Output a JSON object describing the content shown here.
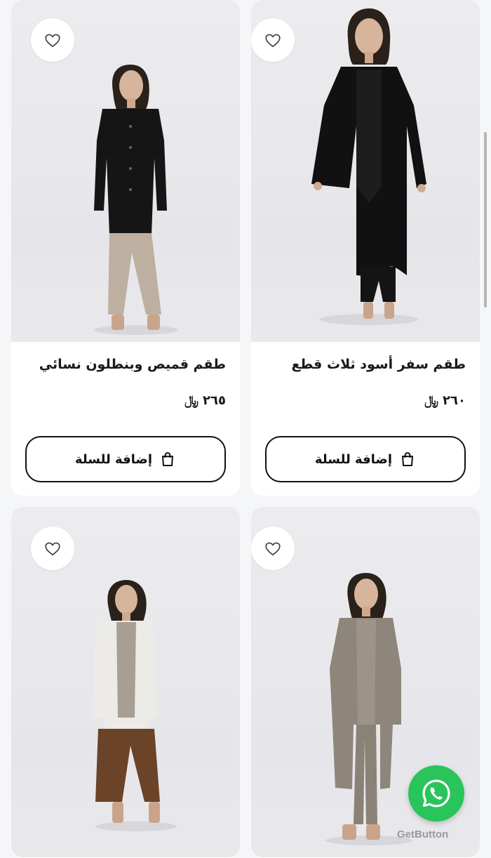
{
  "products": [
    {
      "title": "طقم سفر أسود ثلاث قطع",
      "price": "٢٦٠",
      "currency": "﷼",
      "add_label": "إضافة للسلة"
    },
    {
      "title": "طقم قميص وبنطلون نسائي",
      "price": "٢٦٥",
      "currency": "﷼",
      "add_label": "إضافة للسلة"
    },
    {
      "title": "",
      "price": "",
      "currency": "",
      "add_label": ""
    },
    {
      "title": "",
      "price": "",
      "currency": "",
      "add_label": ""
    }
  ],
  "icons": {
    "favorite": "heart-outline-icon",
    "cart": "shopping-bag-icon",
    "chat": "whatsapp-icon"
  },
  "getbutton_label": "GetButton",
  "colors": {
    "whatsapp": "#29c45a",
    "button_border": "#111111",
    "card_bg": "#ffffff",
    "page_bg": "#f5f6f8"
  }
}
